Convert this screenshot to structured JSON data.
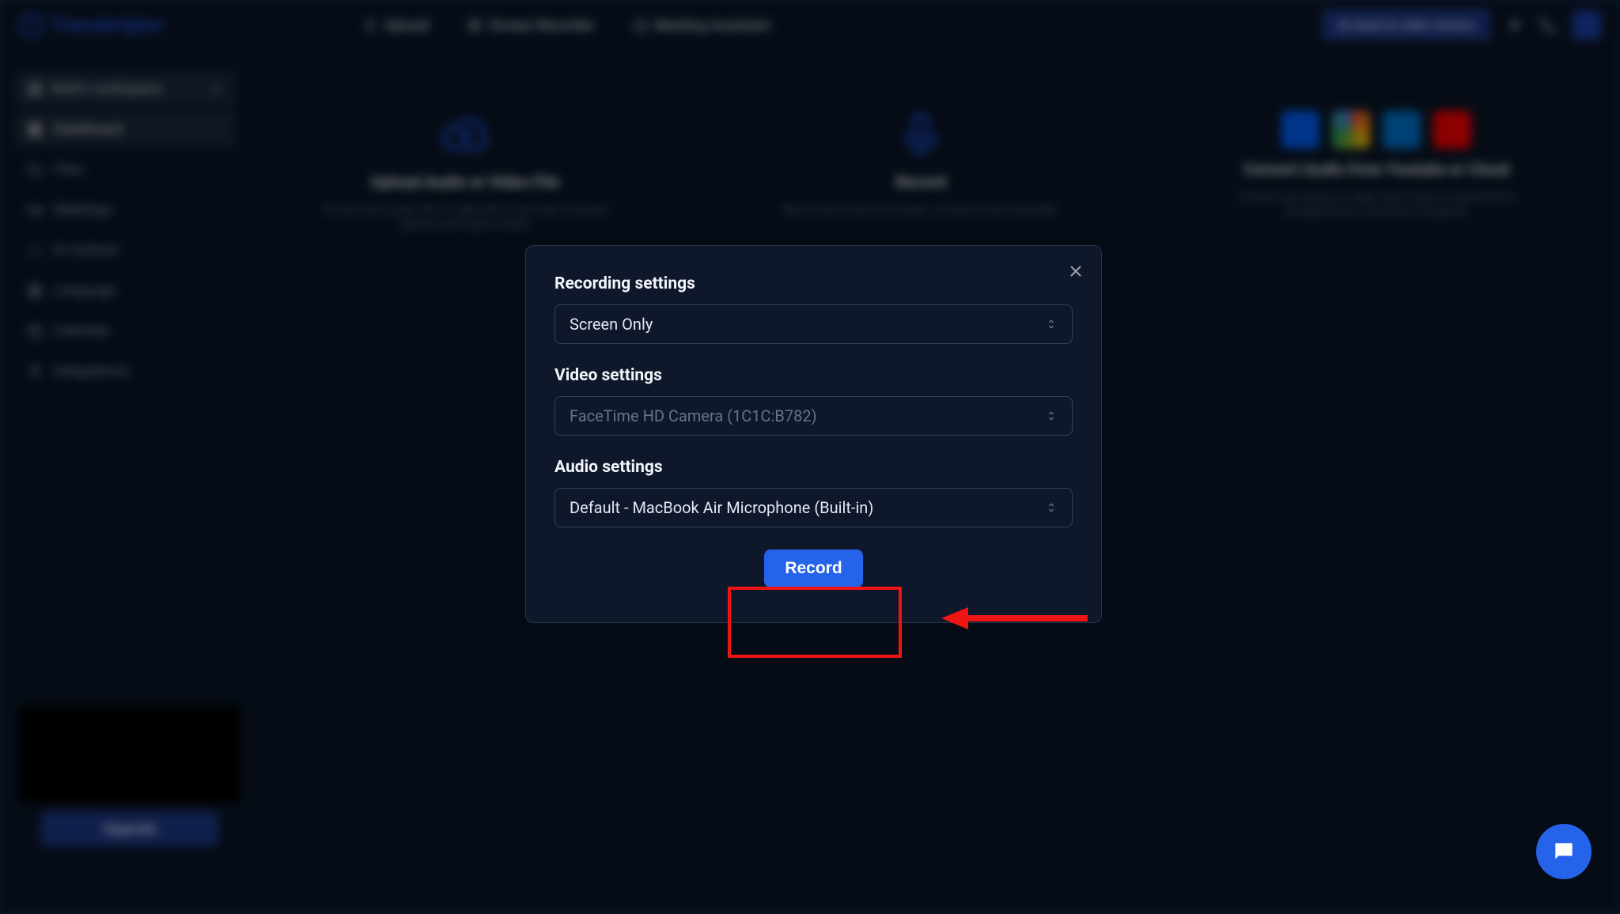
{
  "brand": "Transkriptor",
  "topnav": {
    "tabs": [
      {
        "label": "Upload"
      },
      {
        "label": "Screen Recorder"
      },
      {
        "label": "Meeting Assistant"
      }
    ],
    "go_button": "Go back to older version"
  },
  "sidebar": {
    "workspace": "Berk's workspace",
    "items": [
      {
        "label": "Dashboard"
      },
      {
        "label": "Files"
      },
      {
        "label": "Meetings"
      },
      {
        "label": "AI Actions"
      },
      {
        "label": "Language"
      },
      {
        "label": "Calendar"
      },
      {
        "label": "Integrations"
      }
    ],
    "upgrade": "Upgrade"
  },
  "hero": {
    "upload": {
      "title": "Upload Audio or Video File",
      "sub": "Convert any audio file or video file to text with a simple upload, and export easily."
    },
    "record": {
      "title": "Record",
      "sub": "Record your voice or screen, convert to text instantly."
    },
    "cloud": {
      "title": "Convert Audio from Youtube or Cloud",
      "sub": "Convert any audio or video link to text or upload from storage (Drive, One Drive, Dropbox)."
    }
  },
  "modal": {
    "recording_label": "Recording settings",
    "recording_value": "Screen Only",
    "video_label": "Video settings",
    "video_value": "FaceTime HD Camera (1C1C:B782)",
    "audio_label": "Audio settings",
    "audio_value": "Default - MacBook Air Microphone (Built-in)",
    "record_button": "Record"
  }
}
